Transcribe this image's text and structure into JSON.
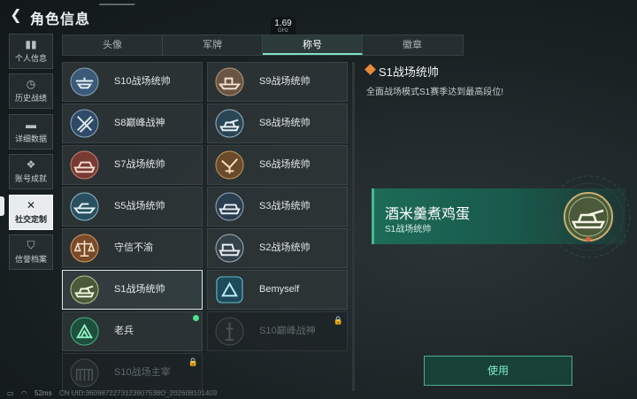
{
  "header": {
    "title": "角色信息"
  },
  "perf": {
    "value": "1.69",
    "unit": "GHz"
  },
  "sidebar": {
    "items": [
      {
        "label": "个人信息",
        "icon": "bar-chart-icon"
      },
      {
        "label": "历史战绩",
        "icon": "clock-icon"
      },
      {
        "label": "详细数据",
        "icon": "folder-icon"
      },
      {
        "label": "账号成就",
        "icon": "medal-icon"
      },
      {
        "label": "社交定制",
        "icon": "tools-icon",
        "active": true
      },
      {
        "label": "信誉档案",
        "icon": "shield-icon"
      }
    ]
  },
  "tabs": [
    {
      "label": "头像"
    },
    {
      "label": "军牌"
    },
    {
      "label": "称号",
      "active": true
    },
    {
      "label": "徽章"
    }
  ],
  "titles": [
    {
      "name": "S10战场统帅",
      "emblem": "emblem-helicopter-icon"
    },
    {
      "name": "S9战场统帅",
      "emblem": "emblem-ship-icon"
    },
    {
      "name": "S8巅峰战神",
      "emblem": "emblem-crossed-rifles-icon"
    },
    {
      "name": "S8战场统帅",
      "emblem": "emblem-tank-icon"
    },
    {
      "name": "S7战场统帅",
      "emblem": "emblem-vehicle-icon"
    },
    {
      "name": "S6战场统帅",
      "emblem": "emblem-eagle-icon"
    },
    {
      "name": "S5战场统帅",
      "emblem": "emblem-boat-icon"
    },
    {
      "name": "S3战场统帅",
      "emblem": "emblem-armored-car-icon"
    },
    {
      "name": "守信不渝",
      "emblem": "emblem-scales-icon"
    },
    {
      "name": "S2战场统帅",
      "emblem": "emblem-truck-icon"
    },
    {
      "name": "S1战场统帅",
      "emblem": "emblem-tank-icon",
      "selected": true
    },
    {
      "name": "Bemyself",
      "emblem": "emblem-custom-icon"
    },
    {
      "name": "老兵",
      "emblem": "emblem-veteran-icon",
      "new": true
    },
    {
      "name": "S10巅峰战神",
      "emblem": "emblem-tower-icon",
      "locked": true
    },
    {
      "name": "S10战场主宰",
      "emblem": "emblem-colosseum-icon",
      "locked": true
    }
  ],
  "detail": {
    "title": "S1战场统帅",
    "description": "全面战场模式S1赛季达到最高段位!"
  },
  "preview": {
    "player_name": "酒米羹煮鸡蛋",
    "title": "S1战场统帅"
  },
  "actions": {
    "use_label": "使用"
  },
  "status": {
    "ping": "52ms",
    "uid": "CN UID:3609872273123907538O_202608101409"
  },
  "colors": {
    "accent": "#7fe0c7",
    "preview_bg": "#1d6b58",
    "new_dot": "#4fe08a",
    "diamond": "#e88a3a"
  }
}
